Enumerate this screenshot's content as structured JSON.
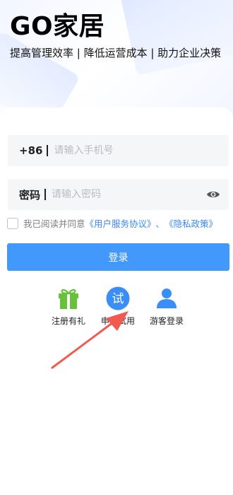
{
  "header": {
    "brand_title": "GO家居",
    "tagline": "提高管理效率 | 降低运营成本 | 助力企业决策"
  },
  "form": {
    "phone": {
      "prefix": "+86",
      "placeholder": "请输入手机号",
      "value": ""
    },
    "password": {
      "label": "密码",
      "placeholder": "请输入密码",
      "value": "",
      "toggle_icon": "eye-icon"
    },
    "agreement": {
      "text": "我已阅读并同意",
      "link1": "《用户服务协议》",
      "separator": "、",
      "link2": "《隐私政策》",
      "checked": false
    },
    "login_label": "登录"
  },
  "options": [
    {
      "label": "注册有礼",
      "icon": "gift-icon",
      "color": "#67c23a"
    },
    {
      "label": "申请试用",
      "icon": "trial-icon",
      "icon_text": "试",
      "color": "#3a8ef6"
    },
    {
      "label": "游客登录",
      "icon": "user-icon",
      "color": "#3a8ef6"
    }
  ],
  "colors": {
    "accent": "#4398fb",
    "link": "#3a86f7",
    "annotation_arrow": "#f05a4f"
  }
}
